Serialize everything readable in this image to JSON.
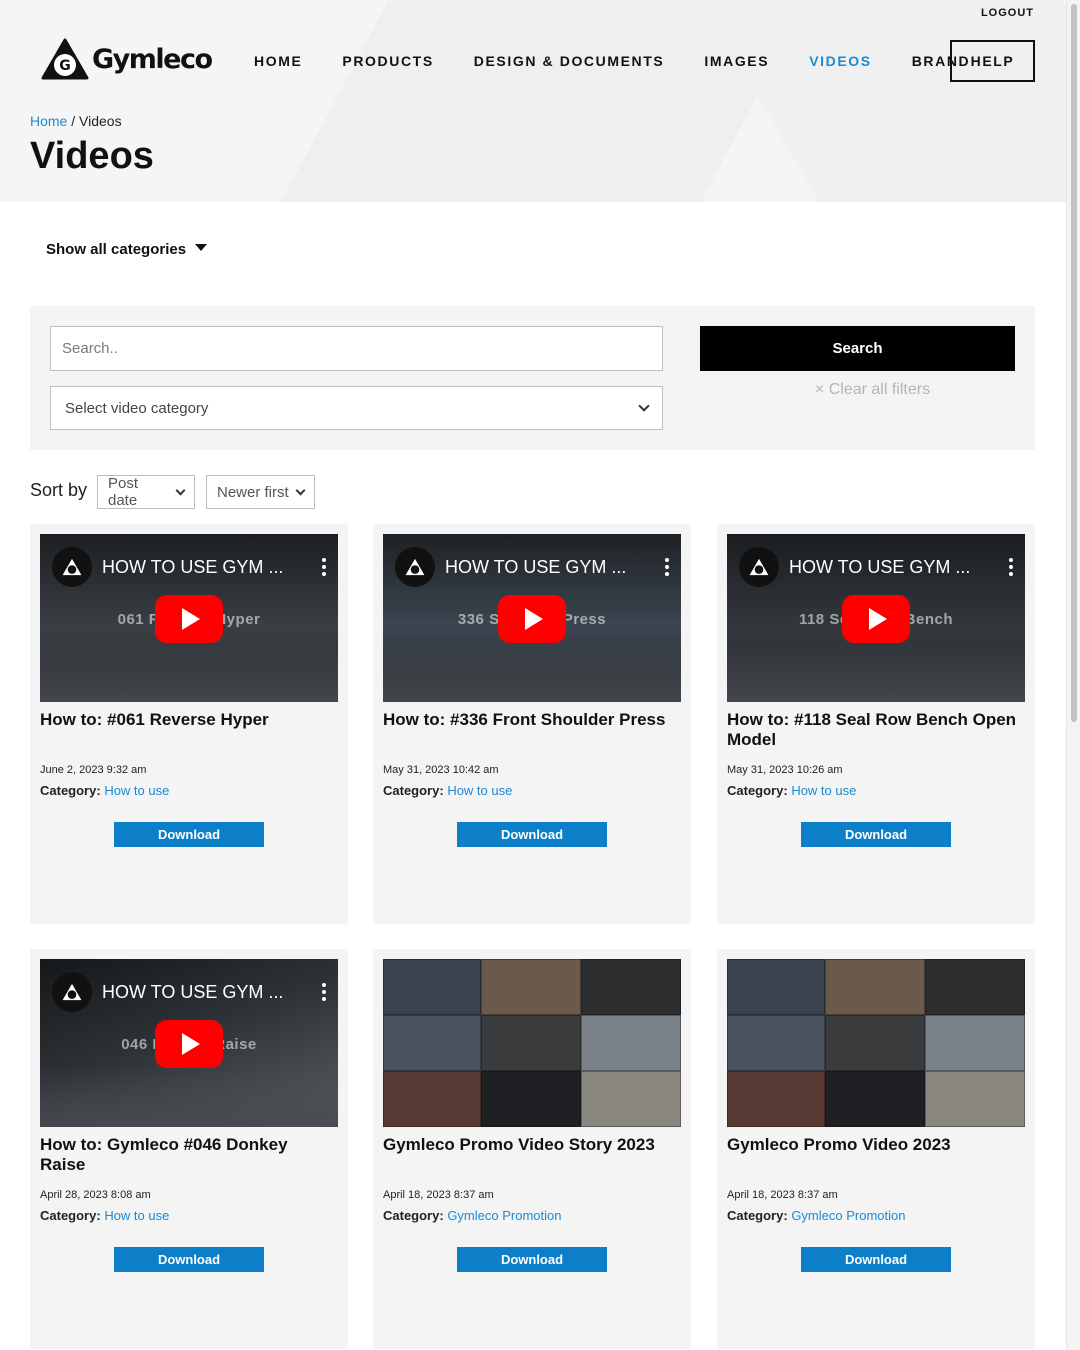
{
  "header": {
    "logout_label": "LOGOUT",
    "logo_text": "Gymleco",
    "nav": [
      {
        "label": "HOME",
        "active": false
      },
      {
        "label": "PRODUCTS",
        "active": false
      },
      {
        "label": "DESIGN & DOCUMENTS",
        "active": false
      },
      {
        "label": "IMAGES",
        "active": false
      },
      {
        "label": "VIDEOS",
        "active": true
      },
      {
        "label": "BRAND",
        "active": false
      }
    ],
    "help_label": "HELP",
    "accent_color": "#1a8ad4"
  },
  "breadcrumb": {
    "home": "Home",
    "separator": " / ",
    "current": "Videos"
  },
  "page_title": "Videos",
  "categories_toggle": "Show all categories",
  "filters": {
    "search_placeholder": "Search..",
    "category_select": "Select video category",
    "search_button": "Search",
    "clear_filters": "× Clear all filters"
  },
  "sort": {
    "label": "Sort by",
    "field": "Post date",
    "order": "Newer first"
  },
  "cards": [
    {
      "video_title": "HOW TO USE GYM ...",
      "overlay": "061 Reverse Hyper",
      "title": "How to: #061 Reverse Hyper",
      "date": "June 2, 2023 9:32 am",
      "category_label": "Category:",
      "category": "How to use",
      "download": "Download",
      "thumbnail": "youtube"
    },
    {
      "video_title": "HOW TO USE GYM ...",
      "overlay": "336 Shoulder Press",
      "title": "How to: #336 Front Shoulder Press",
      "date": "May 31, 2023 10:42 am",
      "category_label": "Category:",
      "category": "How to use",
      "download": "Download",
      "thumbnail": "youtube"
    },
    {
      "video_title": "HOW TO USE GYM ...",
      "overlay": "118 Seal Row Bench",
      "title": "How to: #118 Seal Row Bench Open Model",
      "date": "May 31, 2023 10:26 am",
      "category_label": "Category:",
      "category": "How to use",
      "download": "Download",
      "thumbnail": "youtube"
    },
    {
      "video_title": "HOW TO USE GYM ...",
      "overlay": "046 Donkey Raise",
      "title": "How to: Gymleco #046 Donkey Raise",
      "date": "April 28, 2023 8:08 am",
      "category_label": "Category:",
      "category": "How to use",
      "download": "Download",
      "thumbnail": "youtube"
    },
    {
      "video_title": "",
      "overlay": "",
      "title": "Gymleco Promo Video Story 2023",
      "date": "April 18, 2023 8:37 am",
      "category_label": "Category:",
      "category": "Gymleco Promotion",
      "download": "Download",
      "thumbnail": "collage"
    },
    {
      "video_title": "",
      "overlay": "",
      "title": "Gymleco Promo Video 2023",
      "date": "April 18, 2023 8:37 am",
      "category_label": "Category:",
      "category": "Gymleco Promotion",
      "download": "Download",
      "thumbnail": "collage"
    }
  ],
  "icons": {
    "play": "youtube-play-icon",
    "menu": "more-vert-icon",
    "caret": "caret-down-icon",
    "chevron": "chevron-down-icon"
  }
}
